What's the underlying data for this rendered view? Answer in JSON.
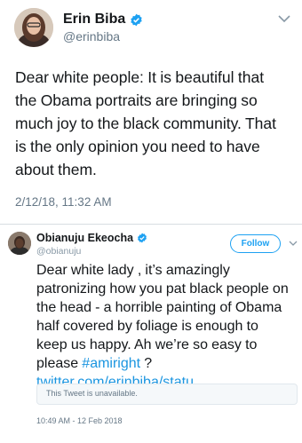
{
  "tweet1": {
    "name": "Erin Biba",
    "handle": "@erinbiba",
    "text_lines": [
      "Dear white people: It is beautiful that",
      "the Obama portraits are bringing so",
      "much joy to the black community. That",
      "is the only opinion you need to have",
      "about them."
    ],
    "timestamp": "2/12/18, 11:32 AM",
    "icons": {
      "verified": "verified-badge-icon",
      "menu": "chevron-down-icon"
    }
  },
  "tweet2": {
    "name": "Obianuju Ekeocha",
    "handle": "@obianuju",
    "follow_label": "Follow",
    "text_lines": [
      "Dear white lady , it’s amazingly",
      "patronizing how you pat black people on",
      "the head - a horrible painting of Obama",
      "half covered by foliage is enough to",
      "keep us happy. Ah we’re so easy to"
    ],
    "last_line_prefix": "please ",
    "hashtag": "#amiright",
    "last_line_suffix": " ?",
    "link": "twitter.com/erinbiba/statu …",
    "quoted_status": "This Tweet is unavailable.",
    "timestamp": "10:49 AM - 12 Feb 2018",
    "icons": {
      "verified": "verified-badge-icon",
      "menu": "chevron-down-icon"
    }
  },
  "colors": {
    "twitter_blue": "#1da1f2",
    "link_blue": "#1b95e0",
    "secondary_text": "#657786"
  }
}
